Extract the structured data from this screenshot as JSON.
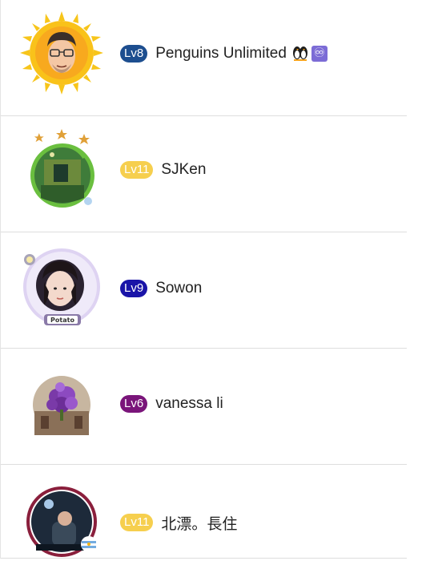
{
  "users": [
    {
      "level": "Lv8",
      "level_color": "#1d4e8f",
      "name": "Penguins Unlimited",
      "emoji_icon": "penguins-emoji-icon",
      "emoji_extra": "♾"
    },
    {
      "level": "Lv11",
      "level_color": "#f6cf4e",
      "name": "SJKen"
    },
    {
      "level": "Lv9",
      "level_color": "#1a14a8",
      "name": "Sowon",
      "avatar_label": "Potato"
    },
    {
      "level": "Lv6",
      "level_color": "#7a157a",
      "name": "vanessa li"
    },
    {
      "level": "Lv11",
      "level_color": "#f6cf4e",
      "name": "北漂。長住"
    }
  ]
}
